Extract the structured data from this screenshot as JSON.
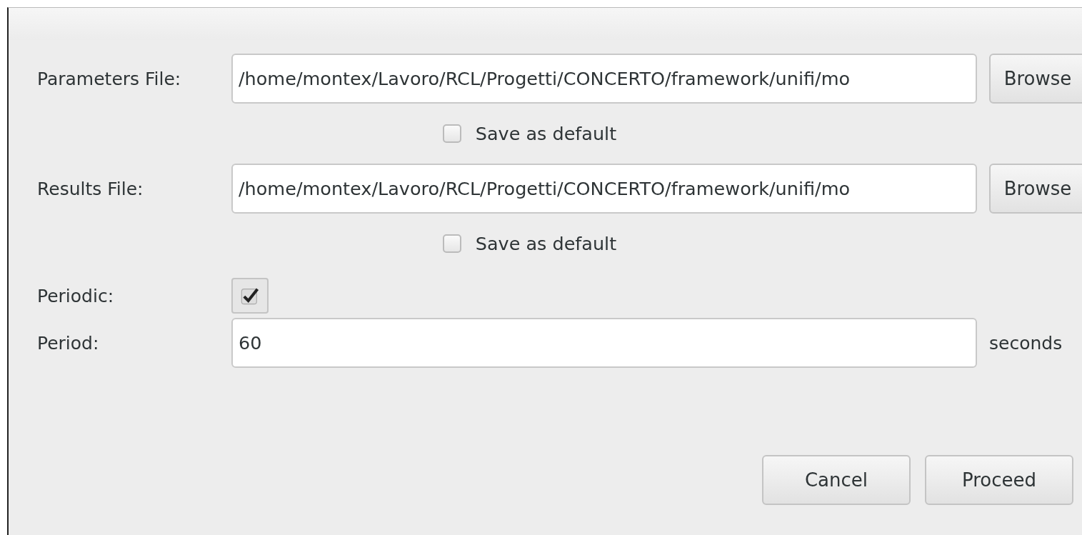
{
  "fields": [
    {
      "label": "Parameters File:",
      "value": "/home/montex/Lavoro/RCL/Progetti/CONCERTO/framework/unifi/mo",
      "button": "Browse",
      "save_default": {
        "label": "Save as default",
        "checked": false
      }
    },
    {
      "label": "Results File:",
      "value": "/home/montex/Lavoro/RCL/Progetti/CONCERTO/framework/unifi/mo",
      "button": "Browse",
      "save_default": {
        "label": "Save as default",
        "checked": false
      }
    }
  ],
  "periodic": {
    "label": "Periodic:",
    "checked": true
  },
  "period": {
    "label": "Period:",
    "value": "60",
    "unit": "seconds"
  },
  "buttons": [
    "Cancel",
    "Proceed"
  ]
}
